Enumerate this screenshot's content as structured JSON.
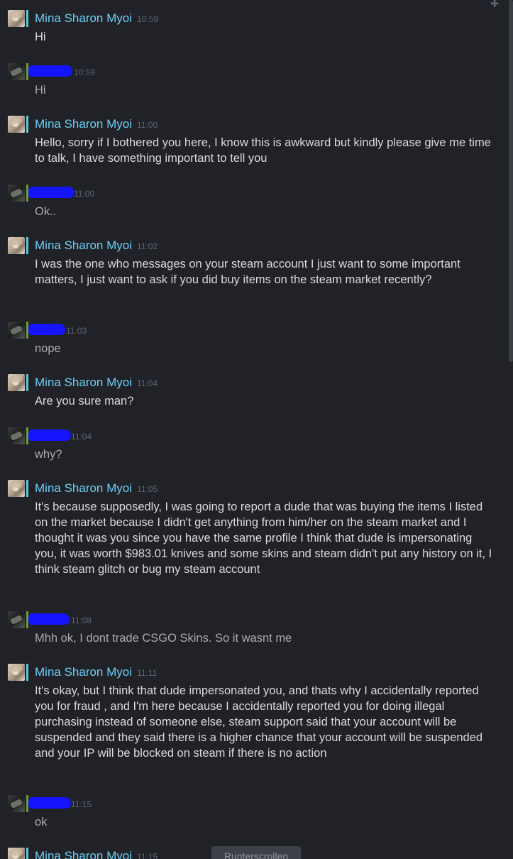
{
  "window": {
    "scroll_button_label": "Runterscrollen"
  },
  "colors": {
    "background": "#202227",
    "name_blue": "#6dcff6",
    "timestamp": "#5d6470",
    "text": "#d9dadc",
    "status_online": "#57cbde",
    "redaction": "#1414ff"
  },
  "messages": [
    {
      "sender": "Mina Sharon Myoi",
      "time": "10:59",
      "text": "Hi"
    },
    {
      "sender": "",
      "time": "10:59",
      "text": "Hi"
    },
    {
      "sender": "Mina Sharon Myoi",
      "time": "11:00",
      "text": "Hello, sorry if I bothered you here, I know this is awkward but kindly please give me time to talk, I have something important to tell you"
    },
    {
      "sender": "",
      "time": "11:00",
      "text": "Ok.."
    },
    {
      "sender": "Mina Sharon Myoi",
      "time": "11:02",
      "text": "I was the one who messages on your steam account I just want to some important matters, I just want to ask if you did buy items on the steam market recently?"
    },
    {
      "sender": "",
      "time": "11:03",
      "text": "nope"
    },
    {
      "sender": "Mina Sharon Myoi",
      "time": "11:04",
      "text": "Are you sure man?"
    },
    {
      "sender": "",
      "time": "11:04",
      "text": "why?"
    },
    {
      "sender": "Mina Sharon Myoi",
      "time": "11:05",
      "text": "It's because supposedly, I was going to report a dude that was buying the items I listed on the market because I didn't get anything from him/her on the steam market and I thought it was you since you have the same profile I think that dude is impersonating you, it was worth $983.01 knives and some skins and steam didn't put any history on it, I think steam glitch or bug my steam account"
    },
    {
      "sender": "",
      "time": "11:08",
      "text": "Mhh ok, I dont trade CSGO Skins. So it wasnt me"
    },
    {
      "sender": "Mina Sharon Myoi",
      "time": "11:11",
      "text": "It's okay, but I think that dude impersonated you, and thats why I accidentally reported you for fraud , and I'm here because I accidentally reported you for doing illegal purchasing instead of someone else, steam support said that your account will be suspended and they said there is a higher chance that your account will be suspended and your IP will be blocked on steam if there is no action"
    },
    {
      "sender": "",
      "time": "11:15",
      "text": "ok"
    },
    {
      "sender": "Mina Sharon Myoi",
      "time": "11:15",
      "text": ""
    }
  ]
}
